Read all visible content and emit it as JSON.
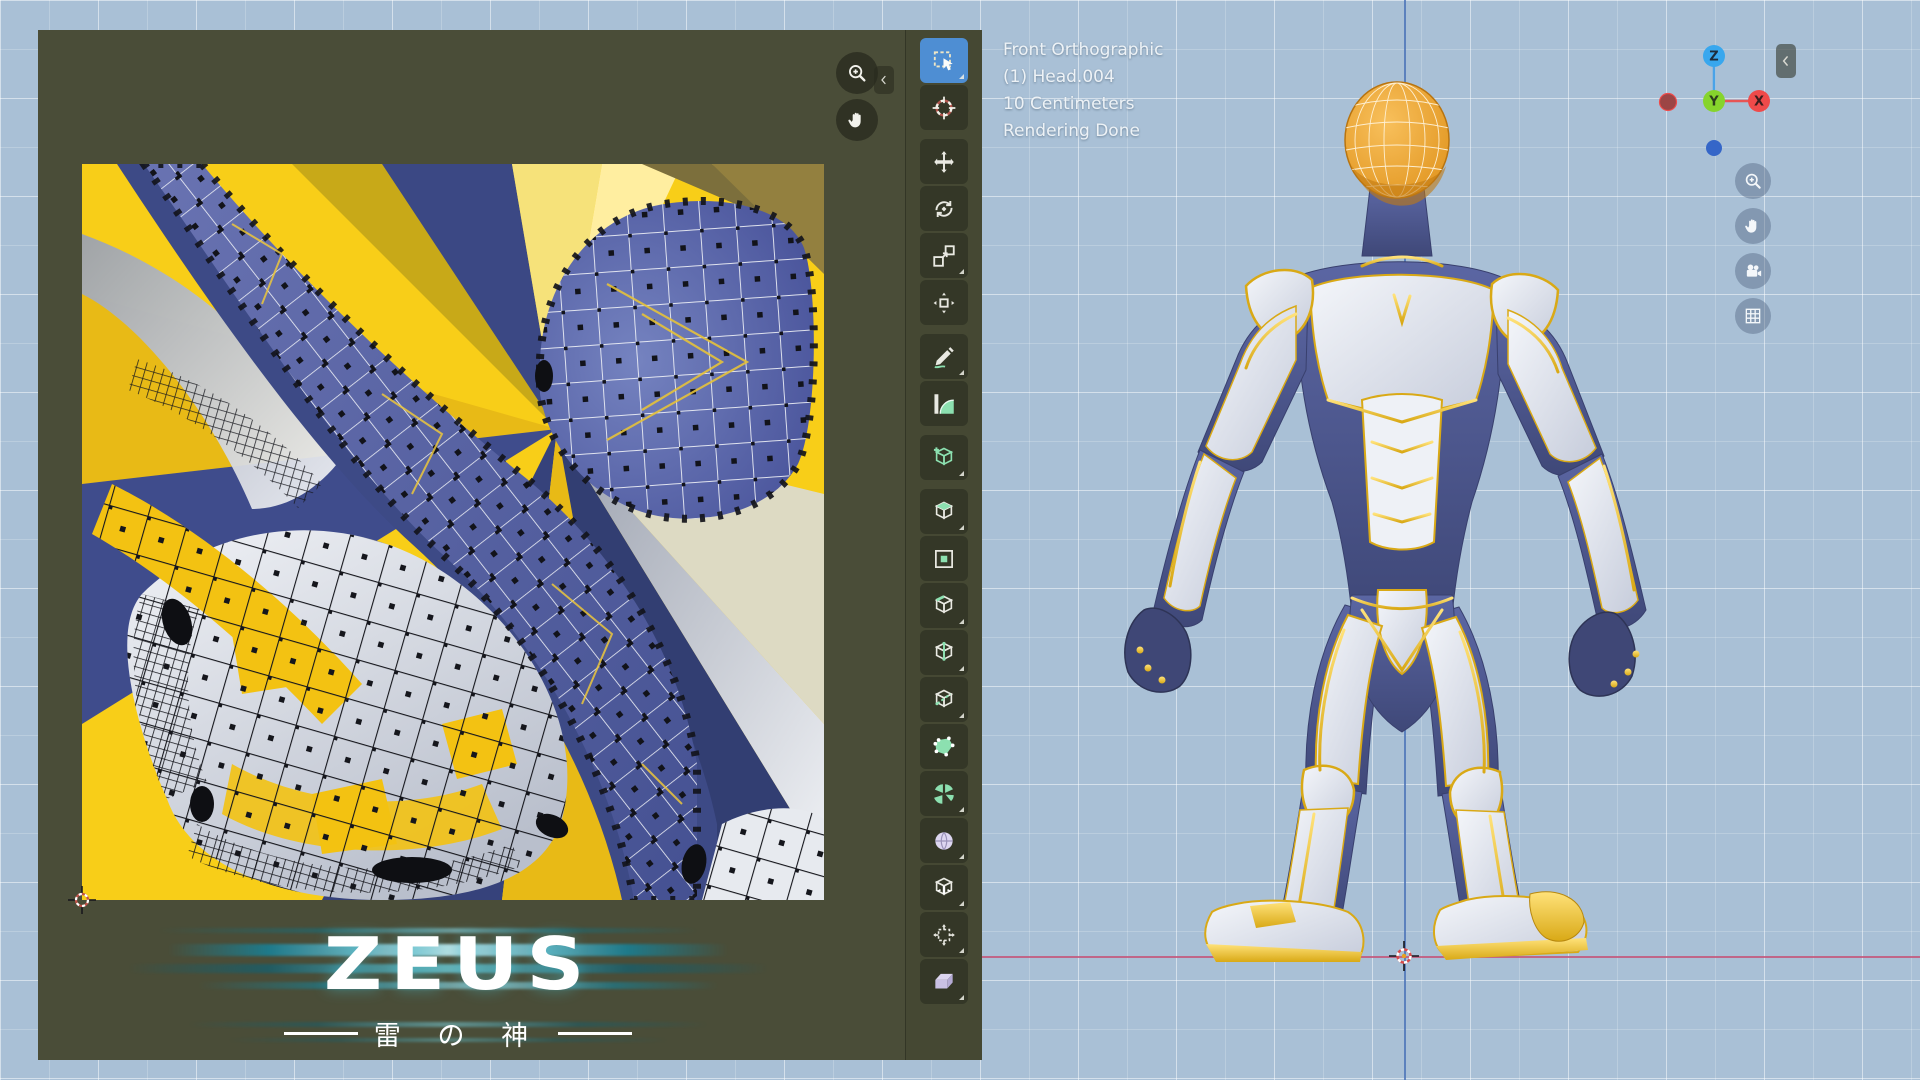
{
  "window": {
    "background": "#a9c0d6"
  },
  "uv_editor": {
    "panel_bg": "#4a4d38",
    "corner_buttons": [
      {
        "id": "zoom",
        "icon": "magnifier-plus-icon"
      },
      {
        "id": "pan",
        "icon": "hand-icon"
      }
    ],
    "collapse_icon": "chevron-left-icon",
    "logo": {
      "title": "ZEUS",
      "subtitle": "雷 の 神",
      "accent_color": "#2db6cc"
    }
  },
  "toolbar": {
    "active_color": "#4e8ed3",
    "accent_color": "#8ce0b0",
    "tools": [
      {
        "id": "select-box",
        "icon": "select-box-icon",
        "group": 0,
        "active": true,
        "has_options": true
      },
      {
        "id": "cursor",
        "icon": "cursor-tool-icon",
        "group": 0,
        "active": false,
        "has_options": false
      },
      {
        "id": "move",
        "icon": "move-icon",
        "group": 1,
        "active": false,
        "has_options": false
      },
      {
        "id": "rotate",
        "icon": "rotate-icon",
        "group": 1,
        "active": false,
        "has_options": false
      },
      {
        "id": "scale",
        "icon": "scale-icon",
        "group": 1,
        "active": false,
        "has_options": true
      },
      {
        "id": "transform",
        "icon": "transform-icon",
        "group": 1,
        "active": false,
        "has_options": false
      },
      {
        "id": "annotate",
        "icon": "annotate-icon",
        "group": 2,
        "active": false,
        "has_options": true
      },
      {
        "id": "measure",
        "icon": "measure-icon",
        "group": 2,
        "active": false,
        "has_options": false
      },
      {
        "id": "add-cube",
        "icon": "add-cube-icon",
        "group": 3,
        "active": false,
        "has_options": true
      },
      {
        "id": "extrude-region",
        "icon": "extrude-icon",
        "group": 4,
        "active": false,
        "has_options": true
      },
      {
        "id": "inset-faces",
        "icon": "inset-icon",
        "group": 4,
        "active": false,
        "has_options": false
      },
      {
        "id": "bevel",
        "icon": "bevel-icon",
        "group": 4,
        "active": false,
        "has_options": true
      },
      {
        "id": "loop-cut",
        "icon": "loop-cut-icon",
        "group": 4,
        "active": false,
        "has_options": true
      },
      {
        "id": "knife",
        "icon": "knife-icon",
        "group": 4,
        "active": false,
        "has_options": true
      },
      {
        "id": "poly-build",
        "icon": "poly-build-icon",
        "group": 4,
        "active": false,
        "has_options": false
      },
      {
        "id": "spin",
        "icon": "spin-icon",
        "group": 4,
        "active": false,
        "has_options": true
      },
      {
        "id": "smooth",
        "icon": "smooth-icon",
        "group": 4,
        "active": false,
        "has_options": true
      },
      {
        "id": "edge-slide",
        "icon": "edge-slide-icon",
        "group": 4,
        "active": false,
        "has_options": true
      },
      {
        "id": "shrink-fatten",
        "icon": "shrink-fatten-icon",
        "group": 4,
        "active": false,
        "has_options": true
      },
      {
        "id": "shear",
        "icon": "shear-icon",
        "group": 4,
        "active": false,
        "has_options": true
      }
    ]
  },
  "viewport": {
    "header_lines": [
      "Front Orthographic",
      "(1) Head.004",
      "10 Centimeters",
      "Rendering Done"
    ],
    "gizmo": {
      "z_label": "Z",
      "y_label": "Y",
      "x_label": "X",
      "z_color": "#38a7ee",
      "y_color": "#86d42c",
      "x_color": "#ef4a4a",
      "neg_x_color": "#9c4545",
      "neg_z_color": "#3566c8"
    },
    "nav_buttons": [
      {
        "id": "zoom",
        "icon": "magnifier-plus-icon"
      },
      {
        "id": "pan",
        "icon": "hand-icon"
      },
      {
        "id": "camera",
        "icon": "camera-icon"
      },
      {
        "id": "grid",
        "icon": "grid-icon"
      }
    ],
    "axis": {
      "x_color": "#c4567a",
      "z_color": "#4870b6"
    }
  }
}
